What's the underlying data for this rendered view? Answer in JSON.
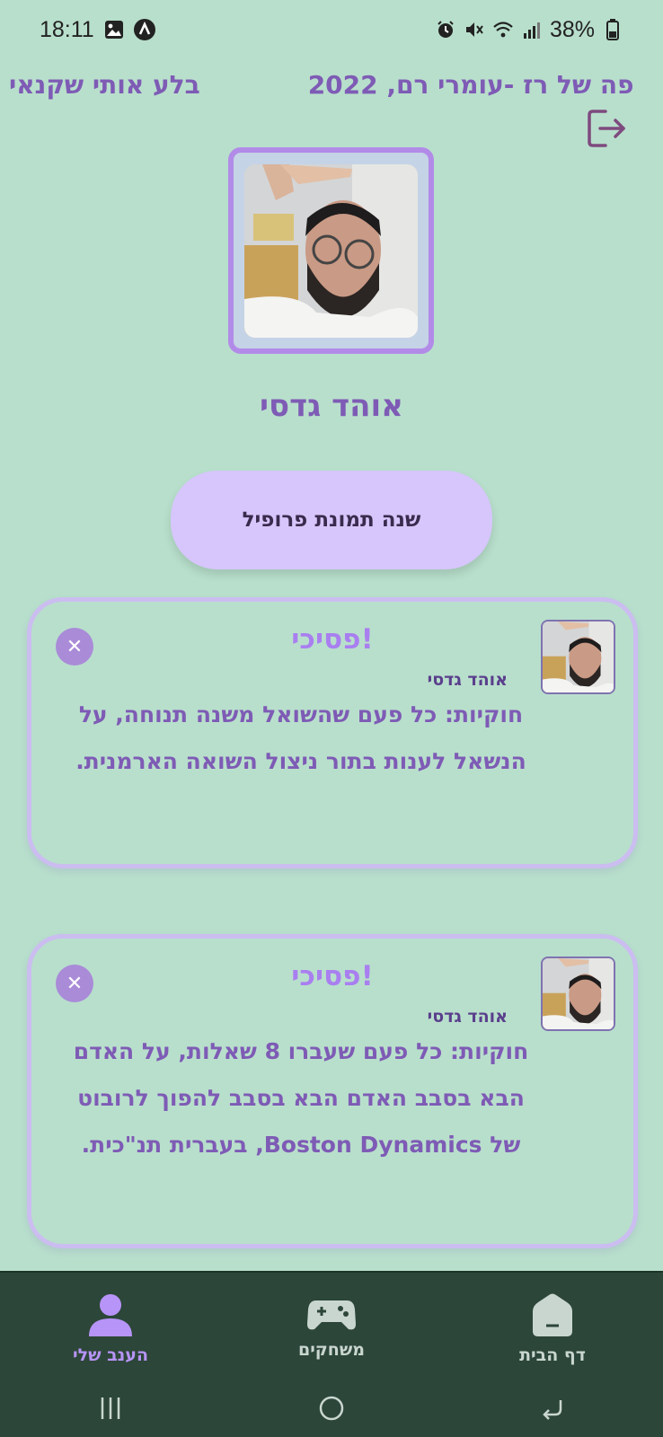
{
  "status_bar": {
    "time": "18:11",
    "battery": "38%",
    "icons_left": [
      "gallery-icon",
      "a-badge-icon"
    ],
    "icons_right": [
      "alarm-icon",
      "mute-icon",
      "wifi-icon",
      "signal-icon",
      "battery-icon"
    ]
  },
  "marquee": {
    "item_1": "פה של רז -עומרי רם, 2022",
    "item_2": "בלע אותי שקנאי"
  },
  "profile": {
    "name": "אוהד גדסי",
    "change_photo_label": "שנה תמונת פרופיל"
  },
  "cards": [
    {
      "title": "פסיכי!",
      "author": "אוהד גדסי",
      "text": "חוקיות: כל פעם שהשואל משנה תנוחה, על הנשאל לענות בתור ניצול השואה הארמנית."
    },
    {
      "title": "פסיכי!",
      "author": "אוהד גדסי",
      "text": "חוקיות: כל פעם שעברו 8 שאלות, על האדם הבא בסבב האדם הבא בסבב להפוך לרובוט של Boston Dynamics, בעברית תנ\"כית."
    }
  ],
  "nav": {
    "home_label": "דף הבית",
    "games_label": "משחקים",
    "my_branch_label": "הענב שלי"
  },
  "colors": {
    "background": "#b8dfcc",
    "accent": "#7e5bb5",
    "nav_bg": "#2c4639"
  }
}
